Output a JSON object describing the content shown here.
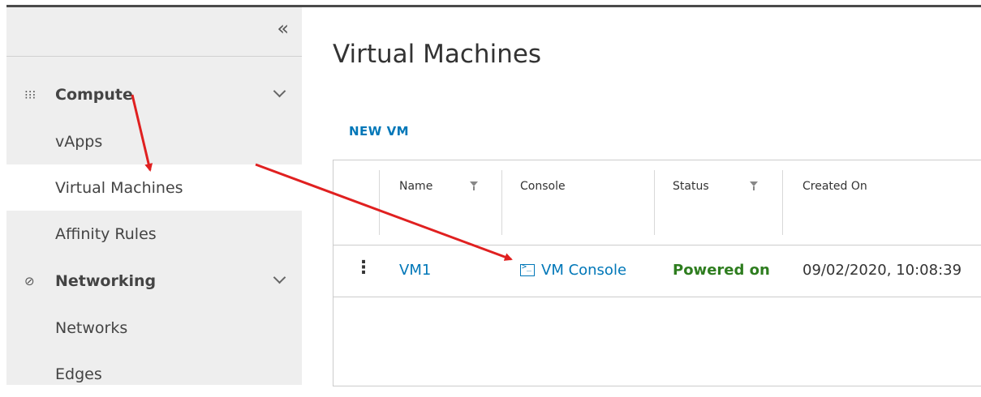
{
  "sidebar": {
    "collapse_icon": "double-chevron-left-icon",
    "groups": [
      {
        "label": "Compute",
        "icon": "grid-dots-icon"
      },
      {
        "label": "Networking",
        "icon": "network-globe-icon"
      }
    ],
    "items": [
      {
        "label": "vApps"
      },
      {
        "label": "Virtual Machines",
        "active": true
      },
      {
        "label": "Affinity Rules"
      },
      {
        "label": "Networks"
      },
      {
        "label": "Edges"
      }
    ]
  },
  "main": {
    "title": "Virtual Machines",
    "new_vm_label": "NEW VM",
    "columns": [
      "Name",
      "Console",
      "Status",
      "Created On"
    ],
    "rows": [
      {
        "name": "VM1",
        "console": "VM Console",
        "status": "Powered on",
        "created_on": "09/02/2020, 10:08:39"
      }
    ]
  },
  "colors": {
    "link": "#0077b8",
    "status_on": "#2e7d1f",
    "annotation_arrow": "#e02020",
    "sidebar_bg": "#eeeeee"
  }
}
